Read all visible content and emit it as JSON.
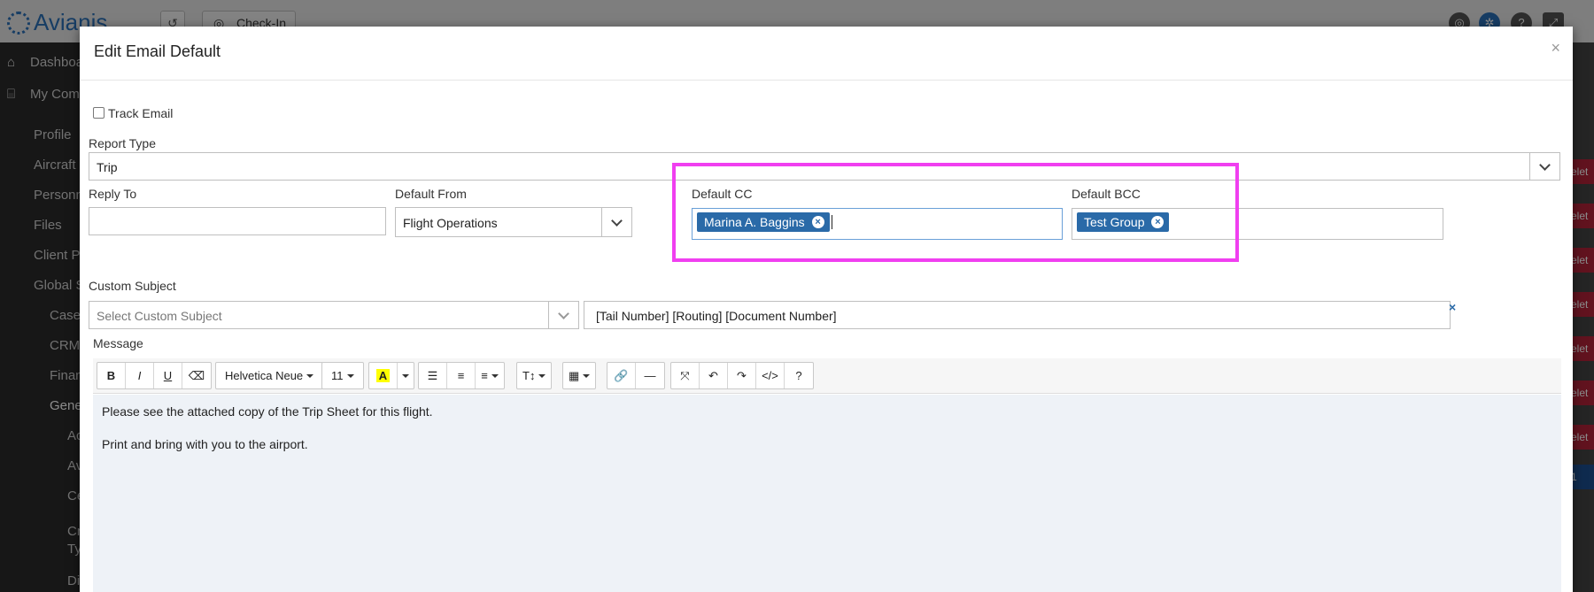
{
  "background": {
    "logo": "Avianis",
    "checkin_label": "Check-In",
    "sidebar_items": [
      {
        "label": "Dashboa",
        "icon": "home-icon"
      },
      {
        "label": "My Com",
        "icon": "bank-icon"
      },
      {
        "label": "Profile"
      },
      {
        "label": "Aircraft"
      },
      {
        "label": "Personn"
      },
      {
        "label": "Files"
      },
      {
        "label": "Client Pe"
      },
      {
        "label": "Global S"
      },
      {
        "label": "Case"
      },
      {
        "label": "CRM"
      },
      {
        "label": "Finan"
      },
      {
        "label": "Gene"
      },
      {
        "label": "Ac"
      },
      {
        "label": "Av"
      },
      {
        "label": "Ce"
      },
      {
        "label": "Cr"
      },
      {
        "label": "Ty"
      },
      {
        "label": "Di"
      }
    ],
    "right_labels": [
      "elet",
      "elet",
      "elet",
      "elet",
      "elet",
      "elet",
      "elet",
      "1"
    ]
  },
  "modal": {
    "title": "Edit Email Default",
    "close": "×",
    "track_email_label": "Track Email",
    "track_email_checked": false,
    "report_type": {
      "label": "Report Type",
      "value": "Trip"
    },
    "reply_to": {
      "label": "Reply To",
      "value": ""
    },
    "default_from": {
      "label": "Default From",
      "value": "Flight Operations"
    },
    "default_cc": {
      "label": "Default CC",
      "tags": [
        "Marina A. Baggins"
      ]
    },
    "default_bcc": {
      "label": "Default BCC",
      "tags": [
        "Test Group"
      ]
    },
    "custom_subject": {
      "label": "Custom Subject",
      "placeholder": "Select Custom Subject",
      "value": "[Tail Number] [Routing] [Document Number]",
      "clear": "×"
    },
    "message": {
      "label": "Message",
      "toolbar": {
        "font_name": "Helvetica Neue",
        "font_size": "11"
      },
      "lines": [
        "Please see the attached copy of the Trip Sheet for this flight.",
        "Print and bring with you to the airport."
      ]
    }
  },
  "colors": {
    "tag_bg": "#2a6aa8",
    "highlight": "#f03ff0"
  }
}
